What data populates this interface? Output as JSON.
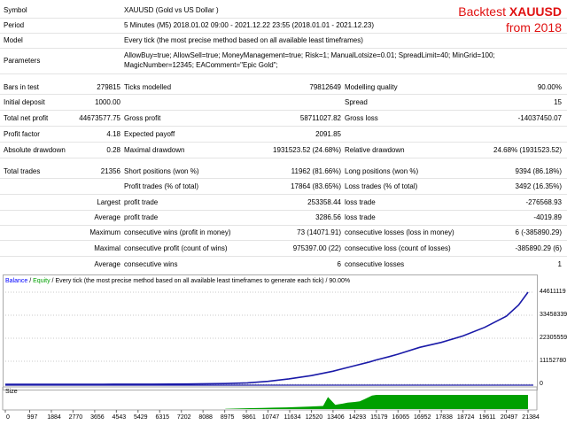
{
  "overlay": {
    "line1_prefix": "Backtest",
    "line1_symbol": "XAUUSD",
    "line2": "from 2018"
  },
  "info": [
    {
      "label": "Symbol",
      "value": "XAUUSD (Gold vs US Dollar )"
    },
    {
      "label": "Period",
      "value": "5 Minutes (M5) 2018.01.02 09:00 - 2021.12.22 23:55 (2018.01.01 - 2021.12.23)"
    },
    {
      "label": "Model",
      "value": "Every tick (the most precise method based on all available least timeframes)"
    },
    {
      "label": "Parameters",
      "value": "AllowBuy=true; AllowSell=true; MoneyManagement=true; Risk=1; ManualLotsize=0.01; SpreadLimit=40; MinGrid=100;",
      "value2": "MagicNumber=12345; EAComment=\"Epic Gold\";"
    }
  ],
  "stats": {
    "bars_label": "Bars in test",
    "bars_value": "279815",
    "ticks_label": "Ticks modelled",
    "ticks_value": "79812649",
    "quality_label": "Modelling quality",
    "quality_value": "90.00%",
    "deposit_label": "Initial deposit",
    "deposit_value": "1000.00",
    "spread_label": "Spread",
    "spread_value": "15",
    "netprofit_label": "Total net profit",
    "netprofit_value": "44673577.75",
    "grossprofit_label": "Gross profit",
    "grossprofit_value": "58711027.82",
    "grossloss_label": "Gross loss",
    "grossloss_value": "-14037450.07",
    "pf_label": "Profit factor",
    "pf_value": "4.18",
    "payoff_label": "Expected payoff",
    "payoff_value": "2091.85",
    "absdd_label": "Absolute drawdown",
    "absdd_value": "0.28",
    "maxdd_label": "Maximal drawdown",
    "maxdd_value": "1931523.52 (24.68%)",
    "reldd_label": "Relative drawdown",
    "reldd_value": "24.68% (1931523.52)",
    "trades_label": "Total trades",
    "trades_value": "21356",
    "short_label": "Short positions (won %)",
    "short_value": "11962 (81.66%)",
    "long_label": "Long positions (won %)",
    "long_value": "9394 (86.18%)",
    "ptrades_label": "Profit trades (% of total)",
    "ptrades_value": "17864 (83.65%)",
    "ltrades_label": "Loss trades (% of total)",
    "ltrades_value": "3492 (16.35%)",
    "largest_label": "Largest",
    "lpt_label": "profit trade",
    "lpt_value": "253358.44",
    "llt_label": "loss trade",
    "llt_value": "-276568.93",
    "average_label": "Average",
    "apt_label": "profit trade",
    "apt_value": "3286.56",
    "alt_label": "loss trade",
    "alt_value": "-4019.89",
    "maximum_label": "Maximum",
    "mcw_label": "consecutive wins (profit in money)",
    "mcw_value": "73 (14071.91)",
    "mcl_label": "consecutive losses (loss in money)",
    "mcl_value": "6 (-385890.29)",
    "maximal_label": "Maximal",
    "mcp_label": "consecutive profit (count of wins)",
    "mcp_value": "975397.00 (22)",
    "mcll_label": "consecutive loss (count of losses)",
    "mcll_value": "-385890.29 (6)",
    "average2_label": "Average",
    "acw_label": "consecutive wins",
    "acw_value": "6",
    "acl_label": "consecutive losses",
    "acl_value": "1"
  },
  "chart": {
    "legend_balance": "Balance",
    "legend_sep1": " / ",
    "legend_equity": "Equity",
    "legend_rest": " / Every tick (the most precise method based on all available least timeframes to generate each tick) / 90.00%",
    "size_label": "Size",
    "colors": {
      "balance": "#1a1aa8",
      "size": "#00a000",
      "grid": "#c8c8c8"
    }
  },
  "chart_data": {
    "type": "line",
    "y_ticks": [
      "44611119",
      "33458339",
      "22305559",
      "11152780",
      "0"
    ],
    "x_ticks": [
      "0",
      "997",
      "1884",
      "2770",
      "3656",
      "4543",
      "5429",
      "6315",
      "7202",
      "8088",
      "8975",
      "9861",
      "10747",
      "11634",
      "12520",
      "13406",
      "14293",
      "15179",
      "16065",
      "16952",
      "17838",
      "18724",
      "19611",
      "20497",
      "21384"
    ],
    "ylim": [
      0,
      44611119
    ],
    "xlim": [
      0,
      21600
    ],
    "series": [
      {
        "name": "Balance",
        "x": [
          0,
          2000,
          4000,
          6000,
          7500,
          8975,
          9900,
          10747,
          11600,
          12520,
          13400,
          14293,
          14900,
          15179,
          15700,
          16065,
          16950,
          17838,
          18724,
          19611,
          20497,
          21000,
          21384
        ],
        "y": [
          0,
          2000,
          8000,
          25000,
          120000,
          350000,
          700000,
          1400000,
          2600000,
          4200000,
          6300000,
          9000000,
          10800000,
          11800000,
          13400000,
          14600000,
          17900000,
          20300000,
          23400000,
          27600000,
          33000000,
          38400000,
          44600000
        ]
      }
    ],
    "size_series": {
      "x": [
        9000,
        9500,
        10000,
        10500,
        11000,
        11500,
        12000,
        12500,
        13000,
        13200,
        13500,
        13800,
        14000,
        14293,
        14500,
        14700,
        15000,
        15179,
        21384
      ],
      "y": [
        0.02,
        0.04,
        0.06,
        0.08,
        0.1,
        0.12,
        0.15,
        0.18,
        0.22,
        0.85,
        0.3,
        0.38,
        0.45,
        0.5,
        0.55,
        0.7,
        0.95,
        1.0,
        1.0
      ]
    }
  }
}
